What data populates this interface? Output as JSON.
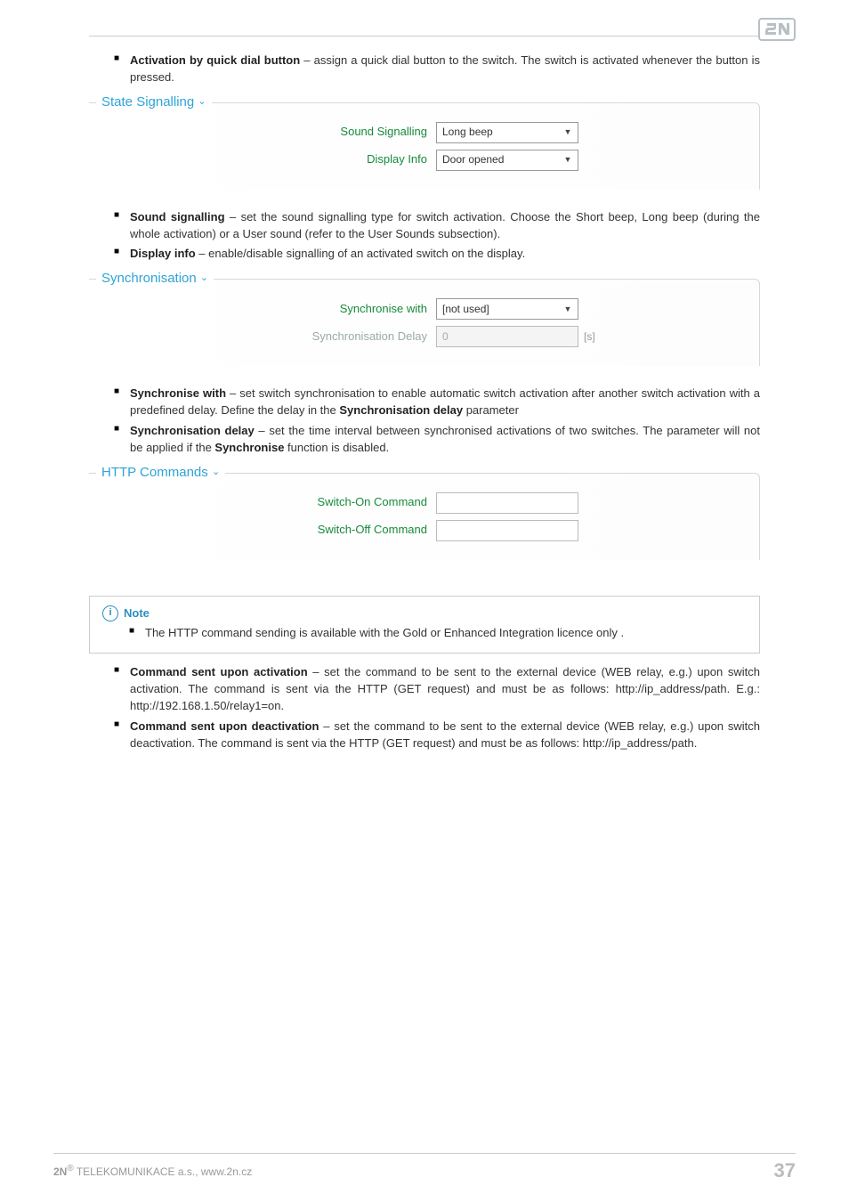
{
  "header": {
    "logo_alt": "2N"
  },
  "bullets_top": [
    {
      "label": "Activation by quick dial button",
      "desc": " – assign a quick dial button to the switch. The switch is activated whenever the button is pressed."
    }
  ],
  "state_signalling": {
    "legend": "State Signalling",
    "rows": [
      {
        "label": "Sound Signalling",
        "value": "Long beep",
        "type": "select"
      },
      {
        "label": "Display Info",
        "value": "Door opened",
        "type": "select"
      }
    ]
  },
  "bullets_sound": [
    {
      "label": "Sound signalling",
      "desc": " – set the sound signalling type for switch activation. Choose the Short beep, Long beep (during the whole activation) or a User sound (refer to the User Sounds subsection)."
    },
    {
      "label": "Display info",
      "desc": " – enable/disable signalling of an activated switch on the display."
    }
  ],
  "synchronisation": {
    "legend": "Synchronisation",
    "rows": [
      {
        "label": "Synchronise with",
        "value": "[not used]",
        "type": "select"
      },
      {
        "label": "Synchronisation Delay",
        "value": "0",
        "type": "text-disabled",
        "unit": "[s]"
      }
    ]
  },
  "bullets_sync": [
    {
      "label": "Synchronise with",
      "desc": " – set switch synchronisation to enable automatic switch activation after another switch activation with a predefined delay. Define the delay in the ",
      "label2": "Synchronisation delay",
      "desc2": " parameter"
    },
    {
      "label": "Synchronisation delay",
      "desc": " – set the time interval between synchronised activations of two switches. The parameter will not be applied if the ",
      "label2": "Synchronise",
      "desc2": " function is disabled."
    }
  ],
  "http_commands": {
    "legend": "HTTP Commands",
    "rows": [
      {
        "label": "Switch-On Command",
        "value": "",
        "type": "text"
      },
      {
        "label": "Switch-Off Command",
        "value": "",
        "type": "text"
      }
    ]
  },
  "note": {
    "title": "Note",
    "text": "The HTTP command sending is available with the Gold or Enhanced Integration licence only ."
  },
  "bullets_cmd": [
    {
      "label": "Command sent upon activation",
      "desc": " – set the command to be sent to the external device (WEB relay, e.g.) upon switch activation. The command is sent via the HTTP (GET request) and must be as follows: http://ip_address/path. E.g.: http://192.168.1.50/relay1=on."
    },
    {
      "label": "Command sent upon deactivation",
      "desc": " – set the command to be sent to the external device (WEB relay, e.g.) upon switch deactivation. The command is sent via the HTTP (GET request) and must be as follows: http://ip_address/path."
    }
  ],
  "footer": {
    "company": "2N",
    "company_suffix": " TELEKOMUNIKACE a.s., www.2n.cz",
    "reg": "®",
    "page": "37"
  }
}
